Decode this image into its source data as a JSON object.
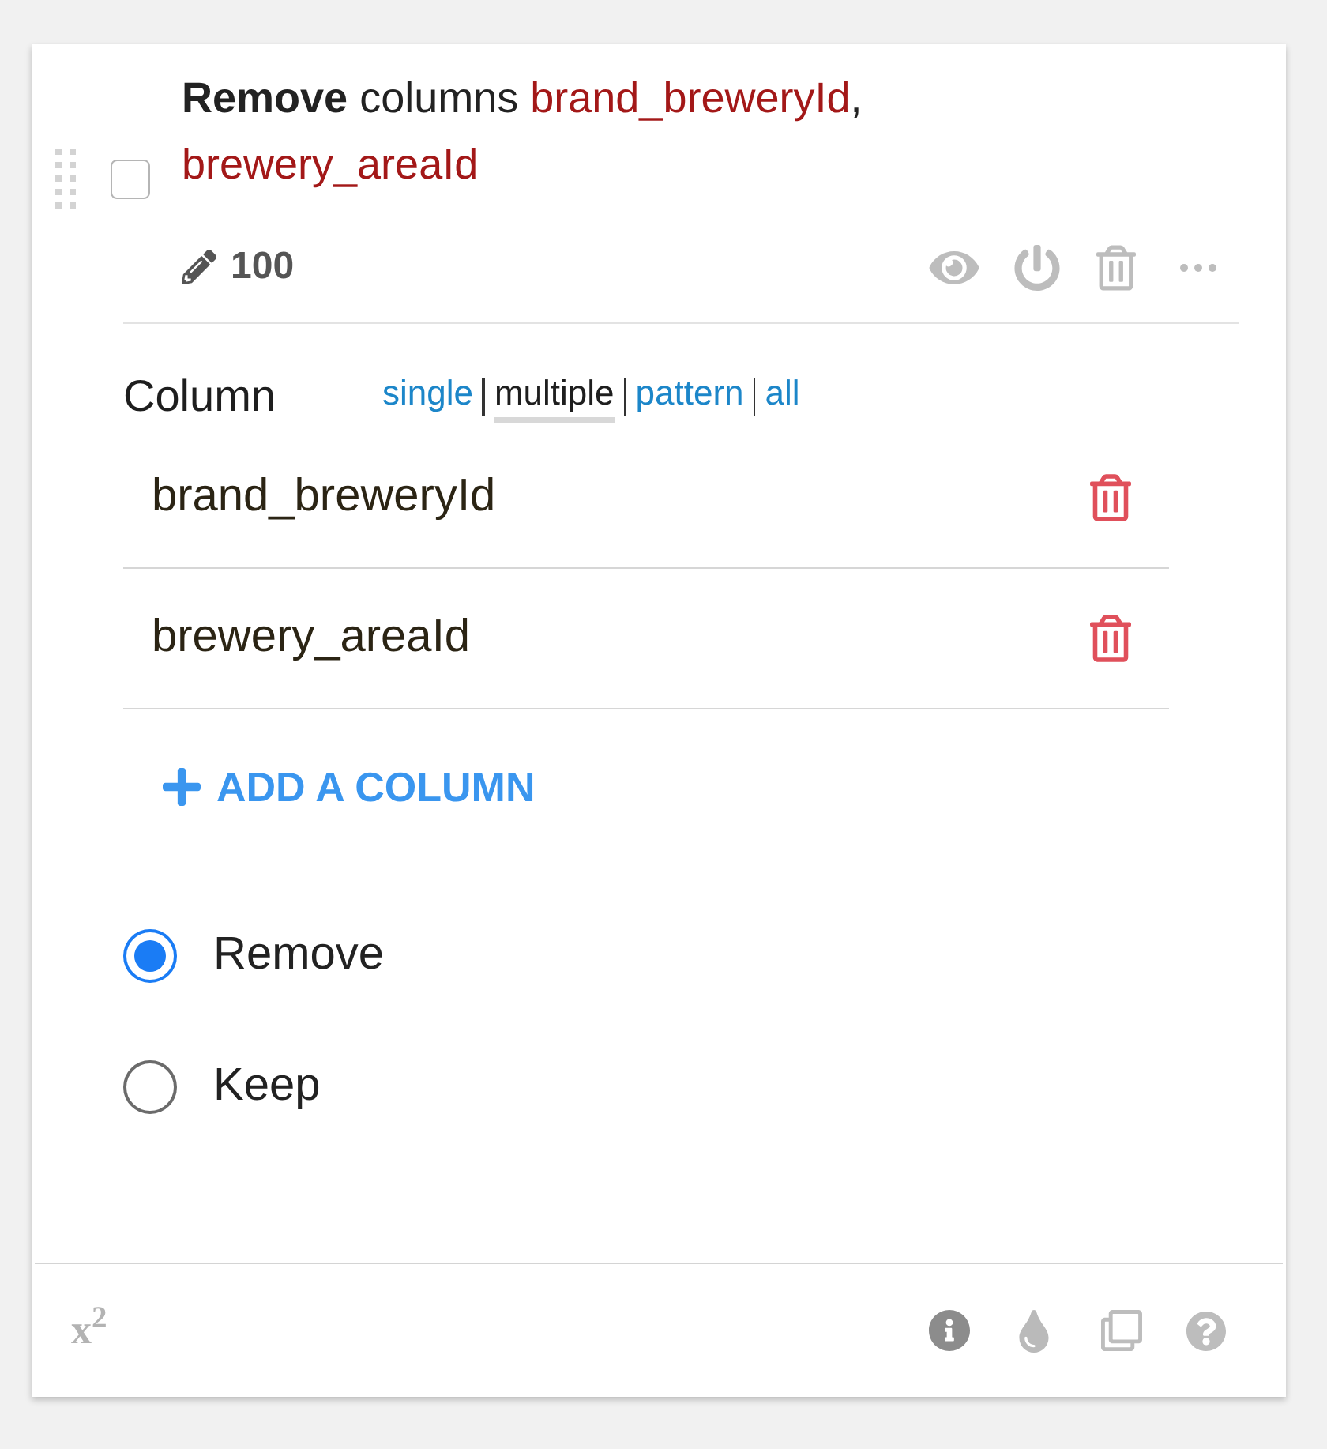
{
  "step": {
    "checked": false,
    "title_parts": [
      {
        "kind": "keyword",
        "text": "Remove"
      },
      {
        "kind": "plain",
        "text": "columns"
      },
      {
        "kind": "column",
        "text": "brand_breweryId"
      },
      {
        "kind": "punctuation",
        "text": ","
      },
      {
        "kind": "column",
        "text": "brewery_areaId"
      }
    ],
    "count": "100"
  },
  "column_field": {
    "label": "Column",
    "modes": [
      {
        "label": "single",
        "selected": false
      },
      {
        "label": "multiple",
        "selected": true
      },
      {
        "label": "pattern",
        "selected": false
      },
      {
        "label": "all",
        "selected": false
      }
    ],
    "columns": [
      {
        "name": "brand_breweryId"
      },
      {
        "name": "brewery_areaId"
      }
    ],
    "add_button": "ADD A COLUMN"
  },
  "action": {
    "options": [
      {
        "label": "Remove",
        "selected": true
      },
      {
        "label": "Keep",
        "selected": false
      }
    ]
  },
  "footer": {
    "formula_button": "x$^{2}$"
  }
}
